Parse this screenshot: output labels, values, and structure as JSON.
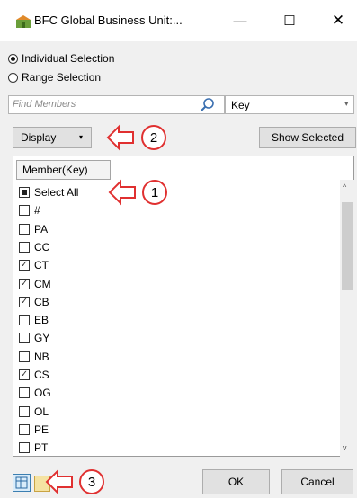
{
  "window": {
    "title": "BFC Global Business Unit:...",
    "minimize_glyph": "—",
    "maximize_glyph": "☐",
    "close_glyph": "✕"
  },
  "selection_mode": {
    "options": [
      {
        "label": "Individual Selection",
        "selected": true
      },
      {
        "label": "Range Selection",
        "selected": false
      }
    ]
  },
  "search": {
    "placeholder": "Find Members",
    "field_value": "Key",
    "dropdown_glyph": "▾"
  },
  "toolbar": {
    "display_label": "Display",
    "display_arrow": "▾",
    "show_selected_label": "Show Selected"
  },
  "grid": {
    "column_header": "Member(Key)",
    "rows": [
      {
        "label": "Select All",
        "state": "partial"
      },
      {
        "label": "#",
        "state": "unchecked"
      },
      {
        "label": "PA",
        "state": "unchecked"
      },
      {
        "label": "CC",
        "state": "unchecked"
      },
      {
        "label": "CT",
        "state": "checked"
      },
      {
        "label": "CM",
        "state": "checked"
      },
      {
        "label": "CB",
        "state": "checked"
      },
      {
        "label": "EB",
        "state": "unchecked"
      },
      {
        "label": "GY",
        "state": "unchecked"
      },
      {
        "label": "NB",
        "state": "unchecked"
      },
      {
        "label": "CS",
        "state": "checked"
      },
      {
        "label": "OG",
        "state": "unchecked"
      },
      {
        "label": "OL",
        "state": "unchecked"
      },
      {
        "label": "PE",
        "state": "unchecked"
      },
      {
        "label": "PT",
        "state": "unchecked"
      }
    ],
    "scroll_up_glyph": "^",
    "scroll_down_glyph": "v"
  },
  "footer": {
    "ok_label": "OK",
    "cancel_label": "Cancel"
  },
  "callouts": [
    {
      "number": "1"
    },
    {
      "number": "2"
    },
    {
      "number": "3"
    }
  ],
  "colors": {
    "callout_red": "#e03030",
    "dialog_bg": "#f0f0f0",
    "button_bg": "#e1e1e1"
  }
}
